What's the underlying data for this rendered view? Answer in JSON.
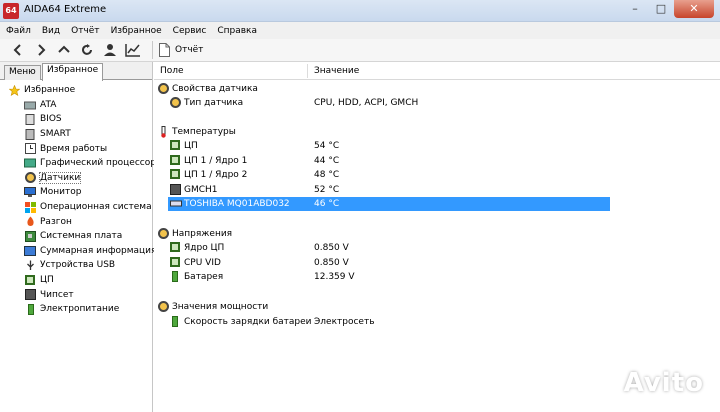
{
  "window": {
    "title": "AIDA64 Extreme",
    "icon_text": "64"
  },
  "menu": [
    "Файл",
    "Вид",
    "Отчёт",
    "Избранное",
    "Сервис",
    "Справка"
  ],
  "toolbar": {
    "report_label": "Отчёт"
  },
  "left_panel": {
    "tabs": [
      "Меню",
      "Избранное"
    ],
    "root_label": "Избранное",
    "items": [
      {
        "label": "ATA",
        "icon": "drive-icon"
      },
      {
        "label": "BIOS",
        "icon": "chip-icon"
      },
      {
        "label": "SMART",
        "icon": "drive-icon"
      },
      {
        "label": "Время работы",
        "icon": "clock-icon"
      },
      {
        "label": "Графический процессор",
        "icon": "gpu-icon"
      },
      {
        "label": "Датчики",
        "icon": "sensor-icon"
      },
      {
        "label": "Монитор",
        "icon": "monitor-icon"
      },
      {
        "label": "Операционная система",
        "icon": "windows-icon"
      },
      {
        "label": "Разгон",
        "icon": "flame-icon"
      },
      {
        "label": "Системная плата",
        "icon": "motherboard-icon"
      },
      {
        "label": "Суммарная информация",
        "icon": "info-icon"
      },
      {
        "label": "Устройства USB",
        "icon": "usb-icon"
      },
      {
        "label": "ЦП",
        "icon": "cpu-icon"
      },
      {
        "label": "Чипсет",
        "icon": "chipset-icon"
      },
      {
        "label": "Электропитание",
        "icon": "power-icon"
      }
    ]
  },
  "columns": {
    "field": "Поле",
    "value": "Значение"
  },
  "sections": [
    {
      "title": "Свойства датчика",
      "icon": "sensor-icon",
      "rows": [
        {
          "field": "Тип датчика",
          "value": "CPU, HDD, ACPI, GMCH",
          "icon": "sensor-icon"
        }
      ]
    },
    {
      "title": "Температуры",
      "icon": "thermometer-icon",
      "rows": [
        {
          "field": "ЦП",
          "value": "54 °C",
          "icon": "chip-icon"
        },
        {
          "field": "ЦП 1 / Ядро 1",
          "value": "44 °C",
          "icon": "chip-icon"
        },
        {
          "field": "ЦП 1 / Ядро 2",
          "value": "48 °C",
          "icon": "chip-icon"
        },
        {
          "field": "GMCH1",
          "value": "52 °C",
          "icon": "chipset-icon"
        },
        {
          "field": "TOSHIBA MQ01ABD032",
          "value": "46 °C",
          "icon": "drive-icon"
        }
      ]
    },
    {
      "title": "Напряжения",
      "icon": "voltage-icon",
      "rows": [
        {
          "field": "Ядро ЦП",
          "value": "0.850 V",
          "icon": "chip-icon"
        },
        {
          "field": "CPU VID",
          "value": "0.850 V",
          "icon": "chip-icon"
        },
        {
          "field": "Батарея",
          "value": "12.359 V",
          "icon": "battery-icon"
        }
      ]
    },
    {
      "title": "Значения мощности",
      "icon": "sensor-icon",
      "rows": [
        {
          "field": "Скорость зарядки батареи",
          "value": "Электросеть",
          "icon": "battery-icon"
        }
      ]
    }
  ],
  "watermark": "Avito"
}
